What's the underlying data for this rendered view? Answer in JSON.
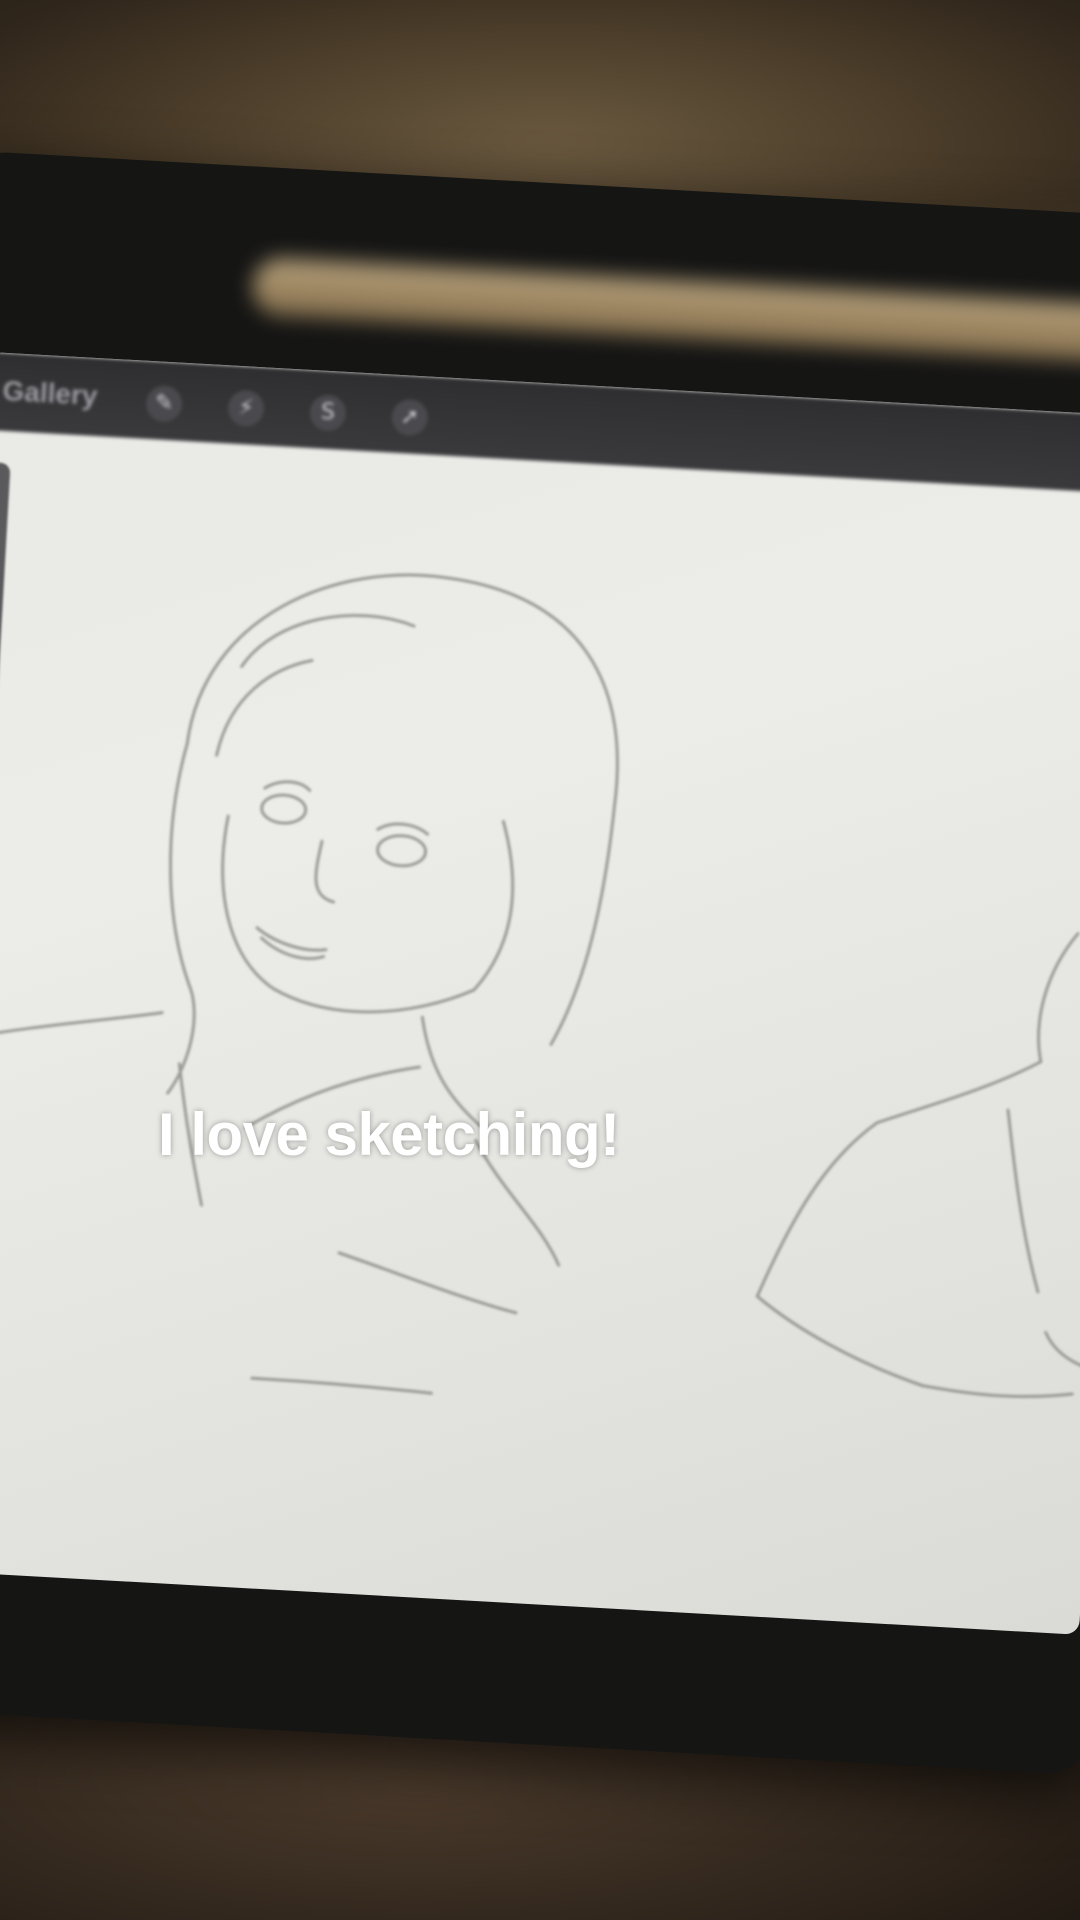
{
  "app": {
    "toolbar": {
      "gallery_label": "Gallery",
      "tools": [
        {
          "name": "wrench-icon",
          "glyph": "✎"
        },
        {
          "name": "magic-wand-icon",
          "glyph": "⚡"
        },
        {
          "name": "selection-icon",
          "glyph": "S"
        },
        {
          "name": "transform-arrow-icon",
          "glyph": "➚"
        }
      ]
    }
  },
  "overlay": {
    "caption": "I love sketching!"
  },
  "colors": {
    "canvas": "#ebebe7",
    "toolbar": "#333335",
    "bezel": "#151514",
    "caption_text": "#ffffff"
  }
}
